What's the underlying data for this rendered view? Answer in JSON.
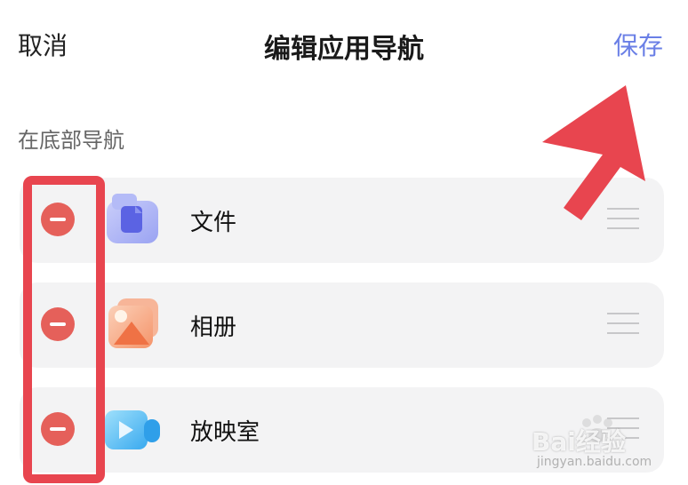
{
  "header": {
    "cancel_label": "取消",
    "title": "编辑应用导航",
    "save_label": "保存"
  },
  "section": {
    "label": "在底部导航"
  },
  "nav_items": [
    {
      "label": "文件",
      "icon": "file-folder-icon"
    },
    {
      "label": "相册",
      "icon": "photo-album-icon"
    },
    {
      "label": "放映室",
      "icon": "video-camera-icon"
    }
  ],
  "watermark": {
    "brand": "Bai经验",
    "url": "jingyan.baidu.com"
  },
  "colors": {
    "accent": "#6a7fe6",
    "remove": "#e5605a",
    "highlight": "#e8454f"
  }
}
